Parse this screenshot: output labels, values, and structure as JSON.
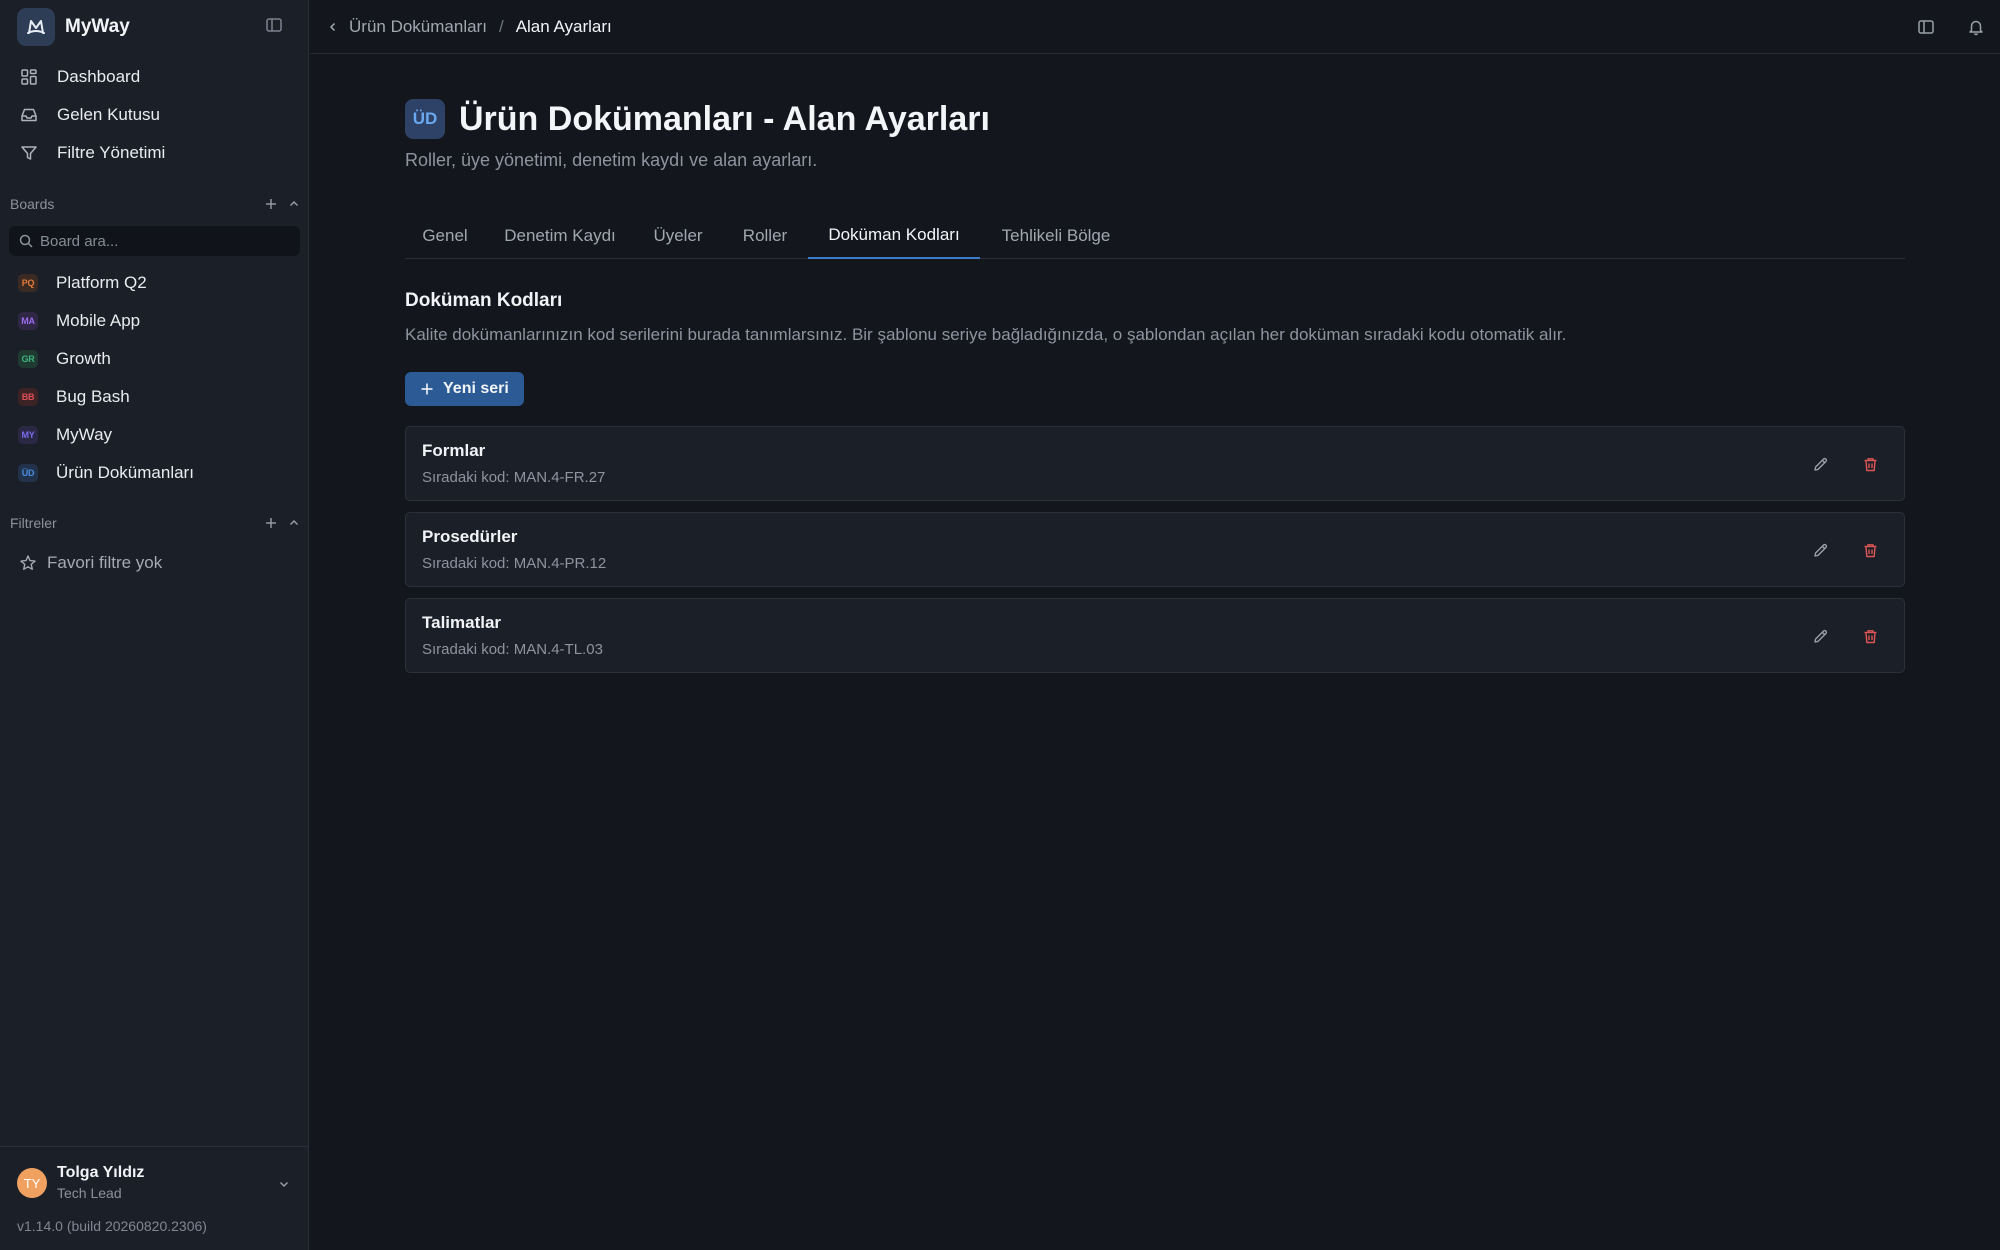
{
  "app": {
    "name": "MyWay",
    "version": "v1.14.0 (build 20260820.2306)"
  },
  "sidebar": {
    "nav": [
      {
        "label": "Dashboard",
        "icon": "dashboard-icon"
      },
      {
        "label": "Gelen Kutusu",
        "icon": "inbox-icon"
      },
      {
        "label": "Filtre Yönetimi",
        "icon": "filter-icon"
      }
    ],
    "boards_title": "Boards",
    "board_search_placeholder": "Board ara...",
    "boards": [
      {
        "abbr": "PQ",
        "label": "Platform Q2",
        "color": "#e07a3a",
        "bg": "#3b2a22"
      },
      {
        "abbr": "MA",
        "label": "Mobile App",
        "color": "#9a6cf0",
        "bg": "#2f2743"
      },
      {
        "abbr": "GR",
        "label": "Growth",
        "color": "#3fb27f",
        "bg": "#1f3a30"
      },
      {
        "abbr": "BB",
        "label": "Bug Bash",
        "color": "#e0505a",
        "bg": "#3d2226"
      },
      {
        "abbr": "MY",
        "label": "MyWay",
        "color": "#7b6cf0",
        "bg": "#2a2844"
      },
      {
        "abbr": "ÜD",
        "label": "Ürün Dokümanları",
        "color": "#4a8ee0",
        "bg": "#22324a"
      }
    ],
    "filters_title": "Filtreler",
    "no_favorites": "Favori filtre yok"
  },
  "user": {
    "initials": "TY",
    "name": "Tolga Yıldız",
    "role": "Tech Lead"
  },
  "breadcrumb": {
    "parent": "Ürün Dokümanları",
    "separator": "/",
    "current": "Alan Ayarları"
  },
  "page": {
    "badge": "ÜD",
    "title": "Ürün Dokümanları - Alan Ayarları",
    "subtitle": "Roller, üye yönetimi, denetim kaydı ve alan ayarları."
  },
  "tabs": [
    {
      "label": "Genel"
    },
    {
      "label": "Denetim Kaydı"
    },
    {
      "label": "Üyeler"
    },
    {
      "label": "Roller"
    },
    {
      "label": "Doküman Kodları",
      "active": true
    },
    {
      "label": "Tehlikeli Bölge"
    }
  ],
  "section": {
    "title": "Doküman Kodları",
    "description": "Kalite dokümanlarınızın kod serilerini burada tanımlarsınız. Bir şablonu seriye bağladığınızda, o şablondan açılan her doküman sıradaki kodu otomatik alır.",
    "new_button": "Yeni seri",
    "next_code_label": "Sıradaki kod:"
  },
  "series": [
    {
      "name": "Formlar",
      "next_code": "MAN.4-FR.27"
    },
    {
      "name": "Prosedürler",
      "next_code": "MAN.4-PR.12"
    },
    {
      "name": "Talimatlar",
      "next_code": "MAN.4-TL.03"
    }
  ],
  "colors": {
    "accent": "#3d7cc9",
    "button": "#2b5a95",
    "danger": "#e05656"
  }
}
